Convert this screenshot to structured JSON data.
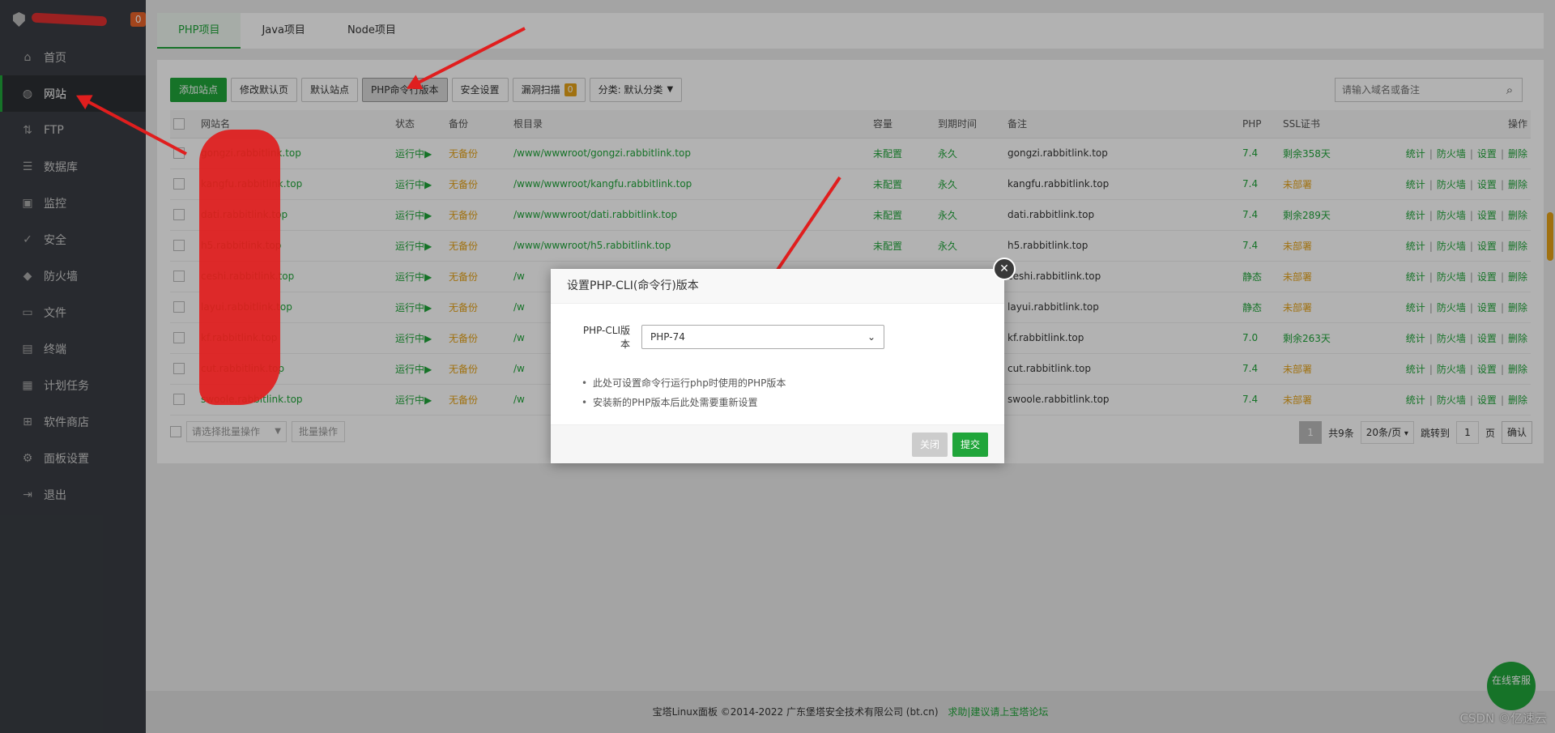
{
  "sidebar": {
    "badge": "0",
    "items": [
      {
        "label": "首页",
        "icon": "home-icon",
        "glyph": "⌂"
      },
      {
        "label": "网站",
        "icon": "globe-icon",
        "glyph": "◍"
      },
      {
        "label": "FTP",
        "icon": "ftp-icon",
        "glyph": "⇅"
      },
      {
        "label": "数据库",
        "icon": "database-icon",
        "glyph": "☰"
      },
      {
        "label": "监控",
        "icon": "monitor-icon",
        "glyph": "▣"
      },
      {
        "label": "安全",
        "icon": "shield-check-icon",
        "glyph": "✓"
      },
      {
        "label": "防火墙",
        "icon": "firewall-icon",
        "glyph": "◆"
      },
      {
        "label": "文件",
        "icon": "folder-icon",
        "glyph": "▭"
      },
      {
        "label": "终端",
        "icon": "terminal-icon",
        "glyph": "▤"
      },
      {
        "label": "计划任务",
        "icon": "calendar-icon",
        "glyph": "▦"
      },
      {
        "label": "软件商店",
        "icon": "apps-icon",
        "glyph": "⊞"
      },
      {
        "label": "面板设置",
        "icon": "gear-icon",
        "glyph": "⚙"
      },
      {
        "label": "退出",
        "icon": "logout-icon",
        "glyph": "⇥"
      }
    ]
  },
  "tabs": [
    "PHP项目",
    "Java项目",
    "Node项目"
  ],
  "toolbar": {
    "add_site": "添加站点",
    "edit_default_page": "修改默认页",
    "default_site": "默认站点",
    "php_cli_version": "PHP命令行版本",
    "security_settings": "安全设置",
    "vuln_scan": "漏洞扫描",
    "vuln_count": "0",
    "category": "分类: 默认分类"
  },
  "search": {
    "placeholder": "请输入域名或备注"
  },
  "table": {
    "headers": {
      "site": "网站名",
      "status": "状态",
      "backup": "备份",
      "root": "根目录",
      "capacity": "容量",
      "expiry": "到期时间",
      "remark": "备注",
      "php": "PHP",
      "ssl": "SSL证书",
      "actions": "操作"
    },
    "action_labels": [
      "统计",
      "防火墙",
      "设置",
      "删除"
    ],
    "rows": [
      {
        "site": "gongzi.rabbitlink.top",
        "status": "运行中▶",
        "backup": "无备份",
        "root": "/www/wwwroot/gongzi.rabbitlink.top",
        "capacity": "未配置",
        "expiry": "永久",
        "remark": "gongzi.rabbitlink.top",
        "php": "7.4",
        "ssl": "剩余358天",
        "ssl_ok": true
      },
      {
        "site": "kangfu.rabbitlink.top",
        "status": "运行中▶",
        "backup": "无备份",
        "root": "/www/wwwroot/kangfu.rabbitlink.top",
        "capacity": "未配置",
        "expiry": "永久",
        "remark": "kangfu.rabbitlink.top",
        "php": "7.4",
        "ssl": "未部署",
        "ssl_ok": false
      },
      {
        "site": "dati.rabbitlink.top",
        "status": "运行中▶",
        "backup": "无备份",
        "root": "/www/wwwroot/dati.rabbitlink.top",
        "capacity": "未配置",
        "expiry": "永久",
        "remark": "dati.rabbitlink.top",
        "php": "7.4",
        "ssl": "剩余289天",
        "ssl_ok": true
      },
      {
        "site": "h5.rabbitlink.top",
        "status": "运行中▶",
        "backup": "无备份",
        "root": "/www/wwwroot/h5.rabbitlink.top",
        "capacity": "未配置",
        "expiry": "永久",
        "remark": "h5.rabbitlink.top",
        "php": "7.4",
        "ssl": "未部署",
        "ssl_ok": false
      },
      {
        "site": "ceshi.rabbitlink.top",
        "status": "运行中▶",
        "backup": "无备份",
        "root": "/w",
        "capacity": "",
        "expiry": "",
        "remark": "ceshi.rabbitlink.top",
        "php": "静态",
        "ssl": "未部署",
        "ssl_ok": false
      },
      {
        "site": "layui.rabbitlink.top",
        "status": "运行中▶",
        "backup": "无备份",
        "root": "/w",
        "capacity": "",
        "expiry": "",
        "remark": "layui.rabbitlink.top",
        "php": "静态",
        "ssl": "未部署",
        "ssl_ok": false
      },
      {
        "site": "kf.rabbitlink.top",
        "status": "运行中▶",
        "backup": "无备份",
        "root": "/w",
        "capacity": "",
        "expiry": "",
        "remark": "kf.rabbitlink.top",
        "php": "7.0",
        "ssl": "剩余263天",
        "ssl_ok": true
      },
      {
        "site": "cut.rabbitlink.top",
        "status": "运行中▶",
        "backup": "无备份",
        "root": "/w",
        "capacity": "",
        "expiry": "",
        "remark": "cut.rabbitlink.top",
        "php": "7.4",
        "ssl": "未部署",
        "ssl_ok": false
      },
      {
        "site": "swoole.rabbitlink.top",
        "status": "运行中▶",
        "backup": "无备份",
        "root": "/w",
        "capacity": "",
        "expiry": "",
        "remark": "swoole.rabbitlink.top",
        "php": "7.4",
        "ssl": "未部署",
        "ssl_ok": false
      }
    ]
  },
  "batch": {
    "select_placeholder": "请选择批量操作",
    "button": "批量操作"
  },
  "pagination": {
    "current": "1",
    "total": "共9条",
    "per_page": "20条/页",
    "jump_label": "跳转到",
    "page_input": "1",
    "page_unit": "页",
    "confirm": "确认"
  },
  "footer": {
    "copyright": "宝塔Linux面板 ©2014-2022 广东堡塔安全技术有限公司 (bt.cn)",
    "help_link": "求助|建议请上宝塔论坛"
  },
  "chat": {
    "label": "在线客服"
  },
  "watermark": "CSDN ©亿速云",
  "dialog": {
    "title": "设置PHP-CLI(命令行)版本",
    "field_label": "PHP-CLI版本",
    "selected_value": "PHP-74",
    "tips": [
      "此处可设置命令行运行php时使用的PHP版本",
      "安装新的PHP版本后此处需要重新设置"
    ],
    "close_label": "关闭",
    "submit_label": "提交"
  },
  "colors": {
    "accent": "#20a53a",
    "warning": "#e6a317",
    "annotation": "#e01e1e",
    "sidebar": "#3a3d44"
  }
}
